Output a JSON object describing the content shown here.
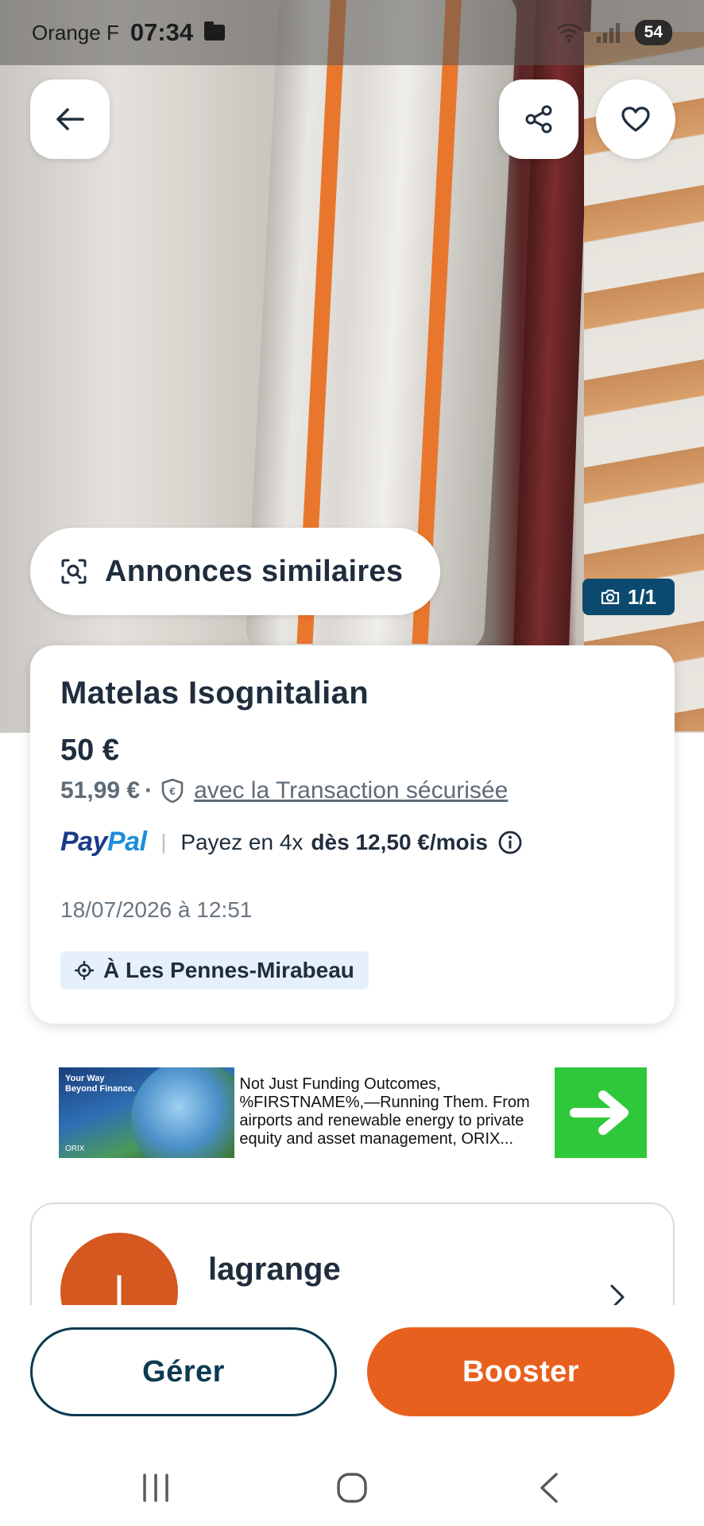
{
  "status_bar": {
    "carrier": "Orange F",
    "time": "07:34",
    "battery": "54"
  },
  "photo": {
    "counter": "1/1"
  },
  "similar_ads": {
    "label": "Annonces similaires"
  },
  "listing": {
    "title": "Matelas Isognitalian",
    "price": "50 €",
    "price_with_protection": "51,99 €",
    "secure_transaction_label": "avec la Transaction sécurisée",
    "paypal": {
      "logo_pay": "Pay",
      "logo_pal": "Pal",
      "installment_prefix": "Payez en 4x",
      "installment_amount": "dès 12,50 €/mois"
    },
    "date": "18/07/2026 à 12:51",
    "location": "À Les Pennes-Mirabeau"
  },
  "ad": {
    "image_headline": "Your Way Beyond Finance.",
    "image_brand": "ORIX",
    "text": "Not Just Funding Outcomes, %FIRSTNAME%,—Running Them. From airports and renewable energy to private equity and asset management, ORIX..."
  },
  "seller": {
    "avatar_initial": "l",
    "name": "lagrange"
  },
  "actions": {
    "manage_label": "Gérer",
    "boost_label": "Booster"
  },
  "colors": {
    "primary_dark": "#0b3a52",
    "accent_orange": "#e8601e",
    "paypal_dark": "#1a3a8a",
    "paypal_light": "#1b8fd8",
    "location_bg": "#e6f0fa"
  }
}
